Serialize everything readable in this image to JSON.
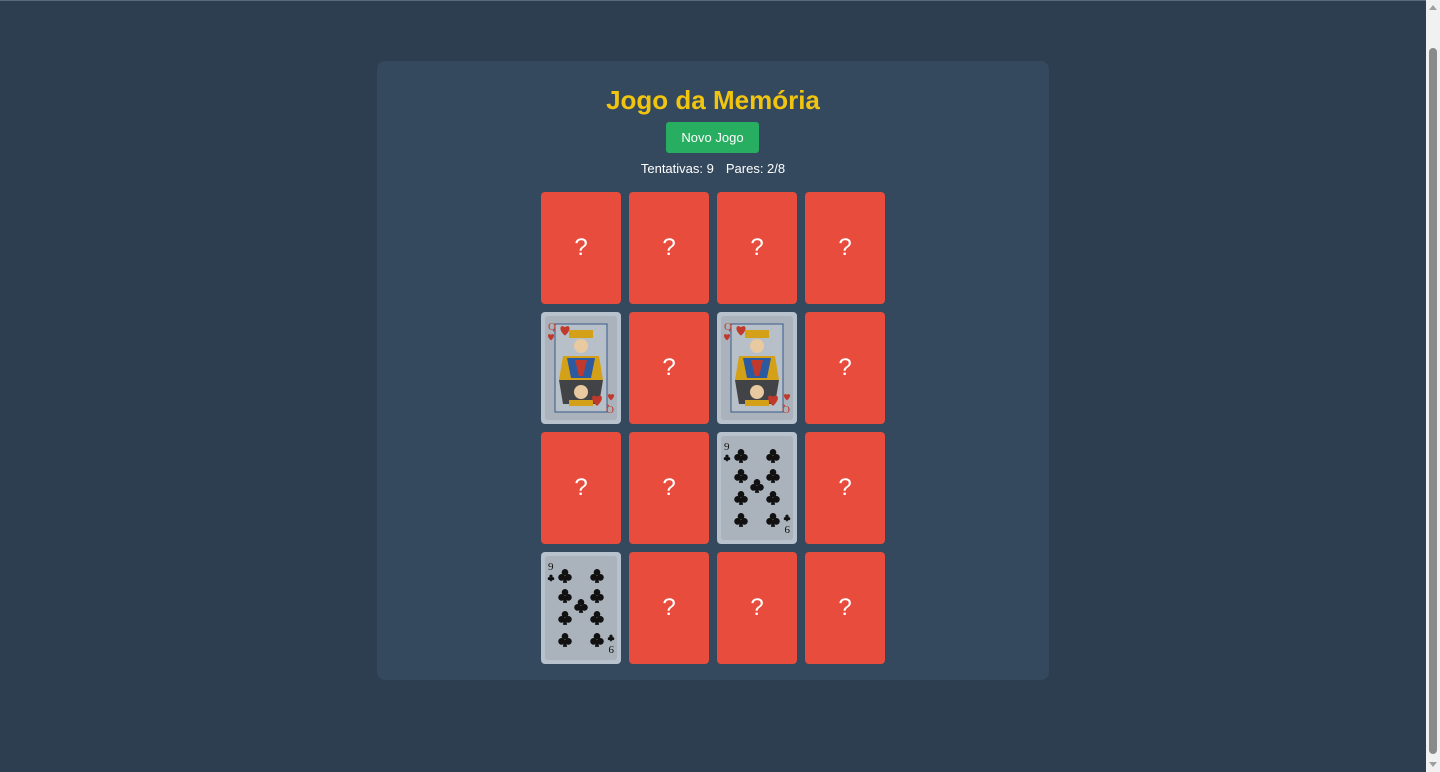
{
  "game": {
    "title": "Jogo da Memória",
    "new_game_label": "Novo Jogo",
    "attempts_text": "Tentativas: 9",
    "pairs_text": "Pares: 2/8"
  },
  "cards": [
    {
      "state": "hidden",
      "label": "?"
    },
    {
      "state": "hidden",
      "label": "?"
    },
    {
      "state": "hidden",
      "label": "?"
    },
    {
      "state": "hidden",
      "label": "?"
    },
    {
      "state": "revealed",
      "rank": "Q",
      "suit": "hearts"
    },
    {
      "state": "hidden",
      "label": "?"
    },
    {
      "state": "revealed",
      "rank": "Q",
      "suit": "hearts"
    },
    {
      "state": "hidden",
      "label": "?"
    },
    {
      "state": "hidden",
      "label": "?"
    },
    {
      "state": "hidden",
      "label": "?"
    },
    {
      "state": "revealed",
      "rank": "9",
      "suit": "clubs"
    },
    {
      "state": "hidden",
      "label": "?"
    },
    {
      "state": "revealed",
      "rank": "9",
      "suit": "clubs"
    },
    {
      "state": "hidden",
      "label": "?"
    },
    {
      "state": "hidden",
      "label": "?"
    },
    {
      "state": "hidden",
      "label": "?"
    }
  ],
  "colors": {
    "background": "#2c3e50",
    "panel": "#34495e",
    "title": "#f1c40f",
    "button": "#27ae60",
    "card_back": "#e74c3c"
  }
}
